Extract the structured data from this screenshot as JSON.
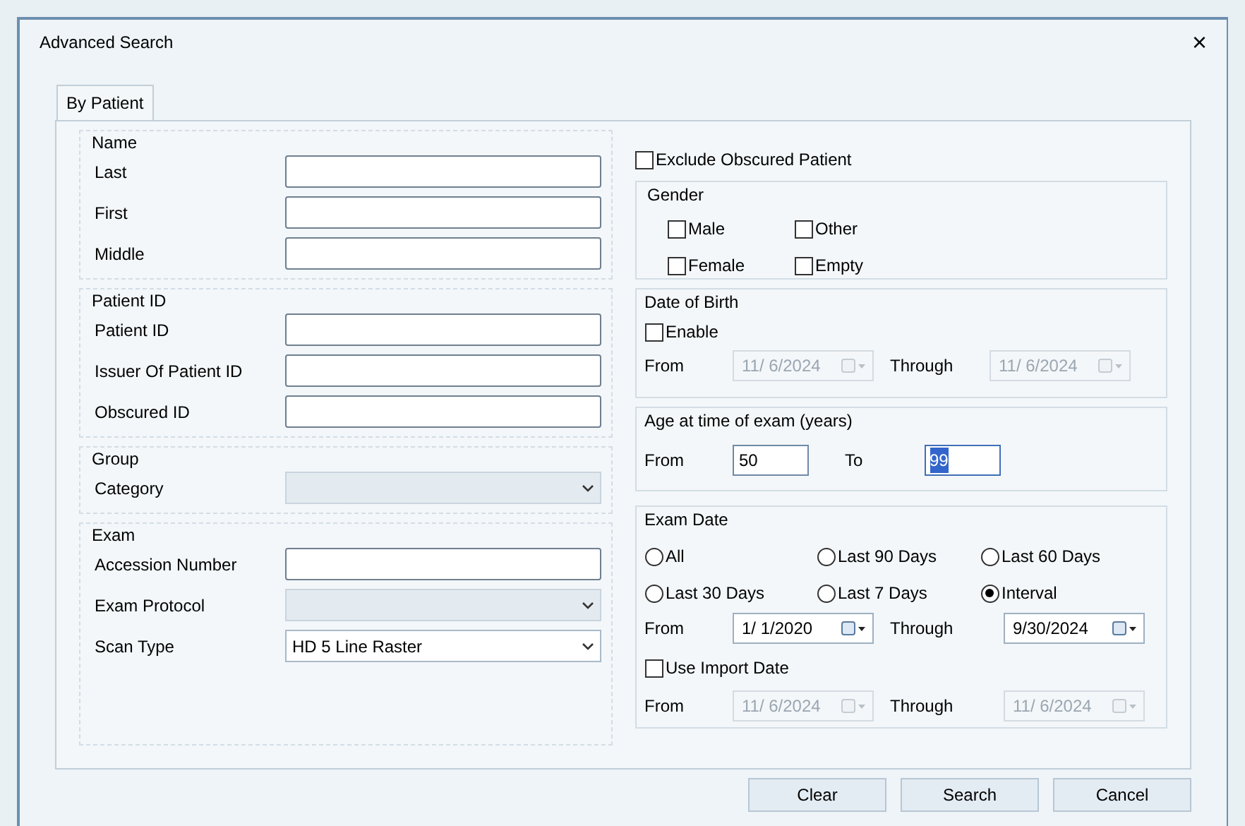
{
  "window": {
    "title": "Advanced Search",
    "close": "×"
  },
  "tabs": [
    {
      "label": "By Patient",
      "selected": true
    }
  ],
  "left_groups": [
    {
      "title": "Name",
      "fields": [
        {
          "label": "Last",
          "kind": "text"
        },
        {
          "label": "First",
          "kind": "text"
        },
        {
          "label": "Middle",
          "kind": "text"
        }
      ]
    },
    {
      "title": "Patient ID",
      "fields": [
        {
          "label": "Patient ID",
          "kind": "text"
        },
        {
          "label": "Issuer Of Patient ID",
          "kind": "text"
        },
        {
          "label": "Obscured ID",
          "kind": "text"
        }
      ]
    },
    {
      "title": "Group",
      "fields": [
        {
          "label": "Category",
          "kind": "combo",
          "disabled": true
        }
      ]
    },
    {
      "title": "Exam",
      "fields": [
        {
          "label": "Accession Number",
          "kind": "text"
        },
        {
          "label": "Exam Protocol",
          "kind": "combo",
          "disabled": true
        },
        {
          "label": "Scan Type",
          "kind": "combo",
          "disabled": false,
          "value": "HD 5 Line Raster"
        }
      ]
    }
  ],
  "exclude_obscured": {
    "label": "Exclude Obscured Patient",
    "checked": false
  },
  "gender": {
    "title": "Gender",
    "options": [
      {
        "label": "Male",
        "checked": false
      },
      {
        "label": "Other",
        "checked": false
      },
      {
        "label": "Female",
        "checked": false
      },
      {
        "label": "Empty",
        "checked": false
      }
    ]
  },
  "date_of_birth": {
    "title": "Date of Birth",
    "enable": {
      "label": "Enable",
      "checked": false
    },
    "from_label": "From",
    "from": {
      "value": "11/ 6/2024",
      "disabled": true
    },
    "through_label": "Through",
    "through": {
      "value": "11/ 6/2024",
      "disabled": true
    }
  },
  "age": {
    "title": "Age at time of exam (years)",
    "from_label": "From",
    "from": "50",
    "to_label": "To",
    "to": "99"
  },
  "exam_date": {
    "title": "Exam Date",
    "options": [
      {
        "label": "All",
        "selected": false
      },
      {
        "label": "Last 90 Days",
        "selected": false
      },
      {
        "label": "Last 60 Days",
        "selected": false
      },
      {
        "label": "Last 30 Days",
        "selected": false
      },
      {
        "label": "Last 7 Days",
        "selected": false
      },
      {
        "label": "Interval",
        "selected": true
      }
    ],
    "from_label": "From",
    "from": {
      "value": "1/ 1/2020",
      "disabled": false
    },
    "through_label": "Through",
    "through": {
      "value": "9/30/2024",
      "disabled": false
    },
    "import": {
      "label": "Use Import Date",
      "checked": false
    },
    "import_from_label": "From",
    "import_from": {
      "value": "11/ 6/2024",
      "disabled": true
    },
    "import_through_label": "Through",
    "import_through": {
      "value": "11/ 6/2024",
      "disabled": true
    }
  },
  "buttons": [
    "Clear",
    "Search",
    "Cancel"
  ]
}
